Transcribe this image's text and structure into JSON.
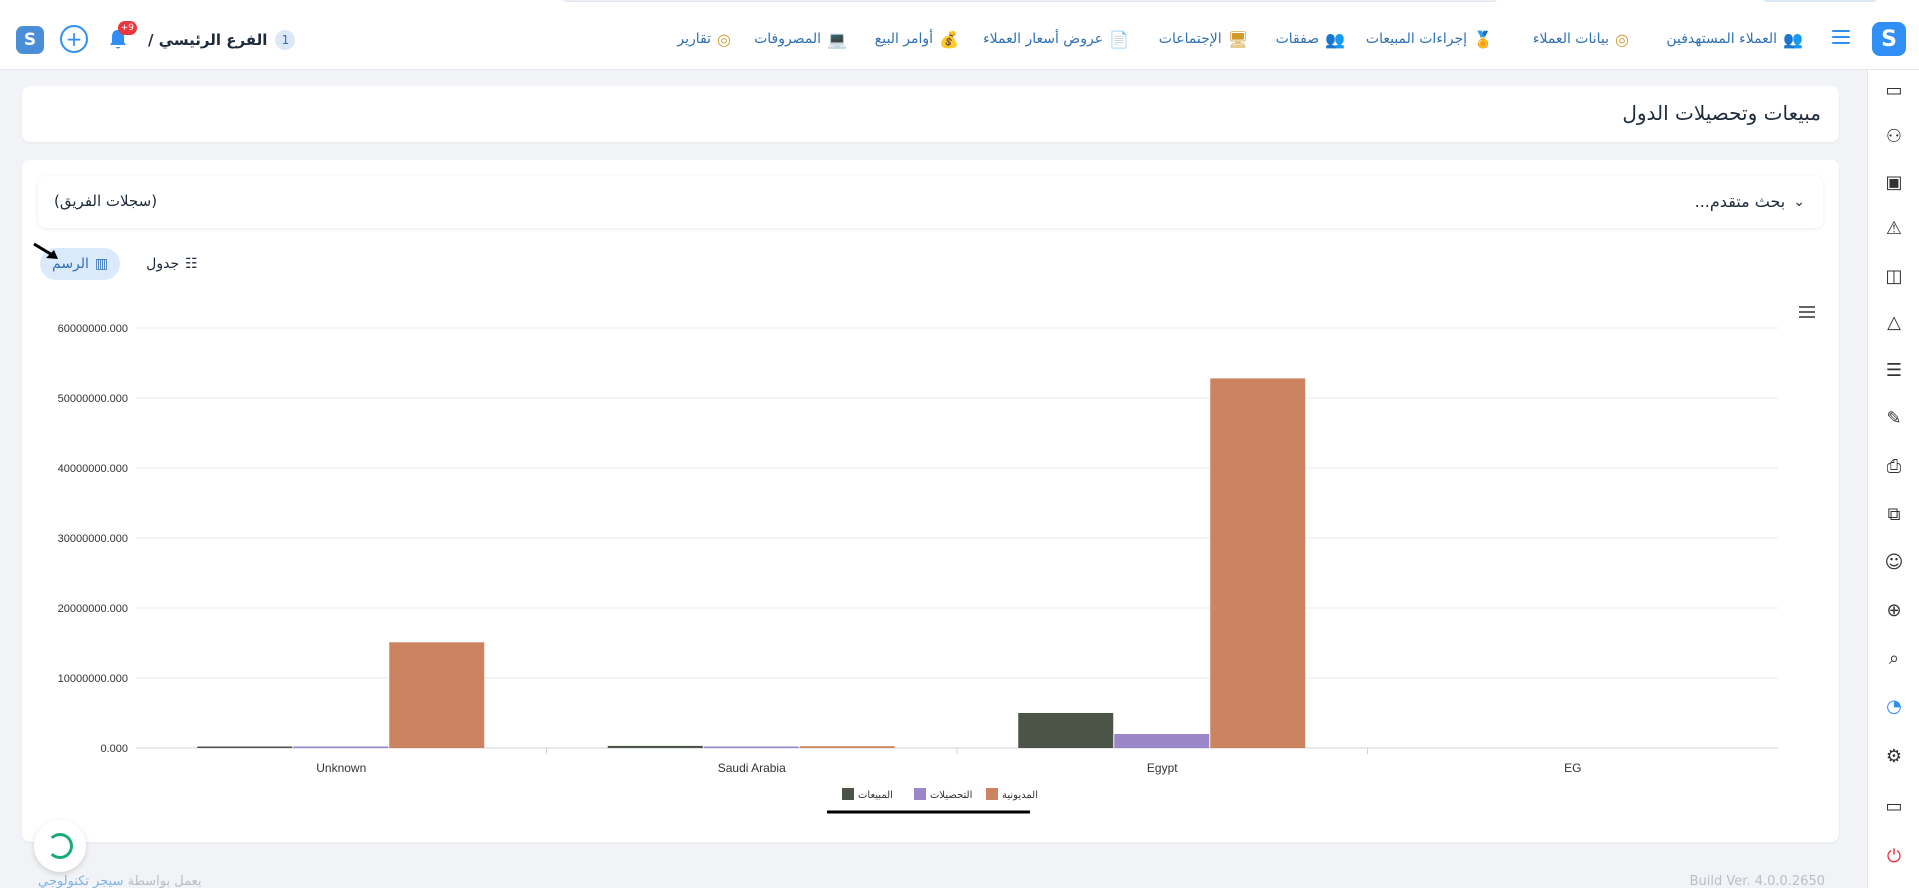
{
  "header": {
    "logo_letter": "S",
    "nav": [
      {
        "label": "العملاء المستهدفين",
        "icon": "👥"
      },
      {
        "label": "بيانات العملاء",
        "icon": "◎"
      },
      {
        "label": "إجراءات المبيعات",
        "icon": "🏅"
      },
      {
        "label": "صفقات",
        "icon": "👥"
      },
      {
        "label": "الإجتماعات",
        "icon": "🖥"
      },
      {
        "label": "عروض أسعار العملاء",
        "icon": "📄"
      },
      {
        "label": "أوامر البيع",
        "icon": "💰"
      },
      {
        "label": "المصروفات",
        "icon": "💻"
      },
      {
        "label": "تقارير",
        "icon": "◎"
      }
    ],
    "branch_number": "1",
    "branch_label": "الفرع الرئيسي /",
    "notification_count": "+9",
    "plus_symbol": "+"
  },
  "page": {
    "title": "مبيعات وتحصيلات الدول"
  },
  "filters": {
    "advanced_search": "بحث متقدم...",
    "team_records": "(سجلات الفريق)"
  },
  "view_toggle": {
    "table_label": "جدول",
    "chart_label": "الرسم"
  },
  "chart_data": {
    "type": "bar",
    "categories": [
      "Unknown",
      "Saudi Arabia",
      "Egypt",
      "EG"
    ],
    "series": [
      {
        "name": "المبيعات",
        "color": "#4c5447",
        "values": [
          150000,
          300000,
          5000000,
          0
        ]
      },
      {
        "name": "التحصيلات",
        "color": "#9a86c8",
        "values": [
          50000,
          80000,
          2000000,
          0
        ]
      },
      {
        "name": "المديونية",
        "color": "#cc8360",
        "values": [
          15100000,
          250000,
          52800000,
          0
        ]
      }
    ],
    "y_ticks": [
      "0.000",
      "10000000.000",
      "20000000.000",
      "30000000.000",
      "40000000.000",
      "50000000.000",
      "60000000.000"
    ],
    "ylim": [
      0,
      60000000
    ],
    "grid": true,
    "legend_position": "bottom-center"
  },
  "footer": {
    "powered_prefix": "يعمل بواسطة",
    "powered_brand": "سيجر تكنولوجي",
    "build": "Build Ver. 4.0.0.2650"
  }
}
